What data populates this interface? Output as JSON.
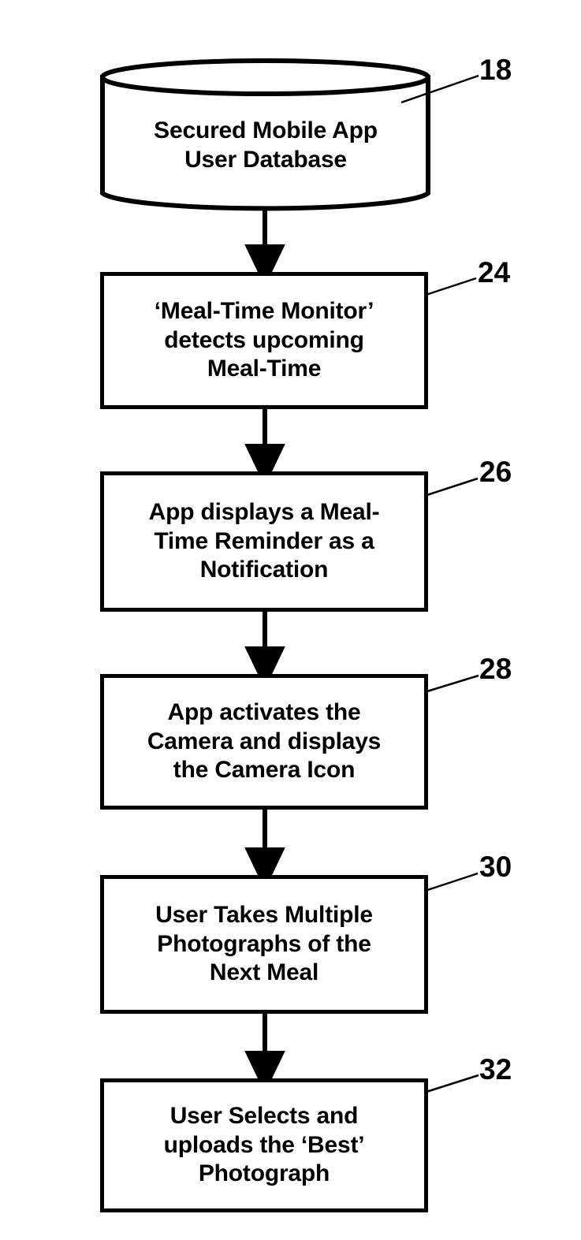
{
  "diagram": {
    "type": "patent-flowchart",
    "background_color": "#ffffff",
    "stroke_color": "#000000",
    "nodes": [
      {
        "id": "db-18",
        "shape": "cylinder",
        "ref": "18",
        "text": "Secured Mobile App\nUser Database"
      },
      {
        "id": "step-24",
        "shape": "rectangle",
        "ref": "24",
        "text": "‘Meal-Time Monitor’\ndetects upcoming\nMeal-Time"
      },
      {
        "id": "step-26",
        "shape": "rectangle",
        "ref": "26",
        "text": "App displays a Meal-\nTime Reminder as a\nNotification"
      },
      {
        "id": "step-28",
        "shape": "rectangle",
        "ref": "28",
        "text": "App activates the\nCamera and displays\nthe Camera Icon"
      },
      {
        "id": "step-30",
        "shape": "rectangle",
        "ref": "30",
        "text": "User Takes Multiple\nPhotographs of the\nNext Meal"
      },
      {
        "id": "step-32",
        "shape": "rectangle",
        "ref": "32",
        "text": "User Selects and\nuploads the ‘Best’\nPhotograph"
      }
    ],
    "connectors": [
      {
        "from": "db-18",
        "to": "step-24",
        "style": "arrow-down"
      },
      {
        "from": "step-24",
        "to": "step-26",
        "style": "arrow-down"
      },
      {
        "from": "step-26",
        "to": "step-28",
        "style": "arrow-down"
      },
      {
        "from": "step-28",
        "to": "step-30",
        "style": "arrow-down"
      },
      {
        "from": "step-30",
        "to": "step-32",
        "style": "arrow-down"
      }
    ]
  }
}
